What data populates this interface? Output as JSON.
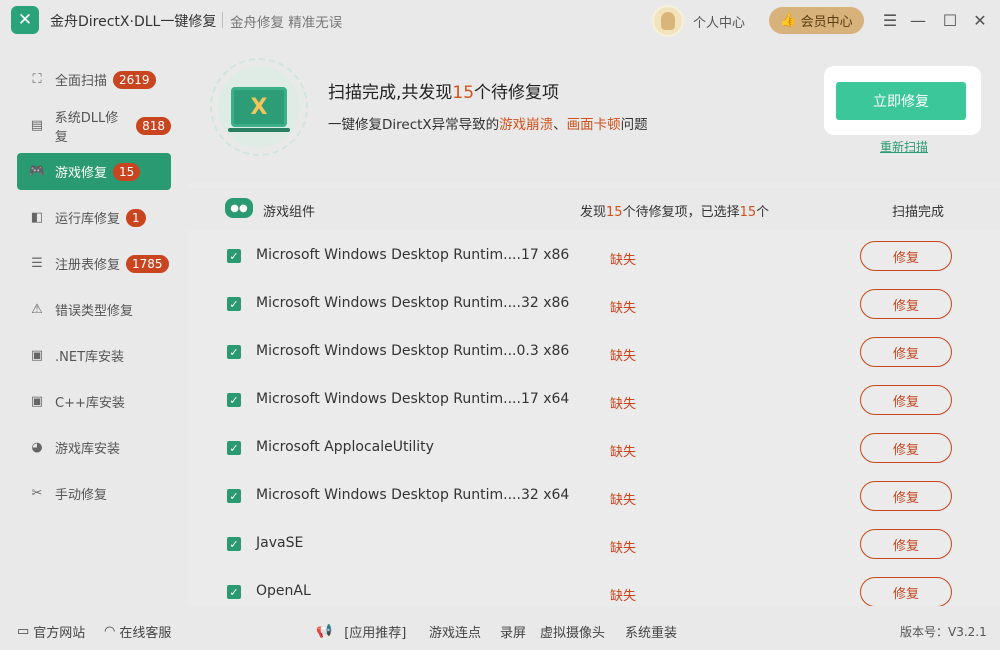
{
  "titlebar": {
    "app_title": "金舟DirectX·DLL一键修复",
    "slogan": "金舟修复 精准无误",
    "user_center": "个人中心",
    "vip_label": "会员中心"
  },
  "sidebar": {
    "items": [
      {
        "label": "全面扫描",
        "badge": "2619",
        "icon": "scan-icon"
      },
      {
        "label": "系统DLL修复",
        "badge": "818",
        "icon": "dll-icon"
      },
      {
        "label": "游戏修复",
        "badge": "15",
        "icon": "gamepad-icon"
      },
      {
        "label": "运行库修复",
        "badge": "1",
        "icon": "runtime-icon"
      },
      {
        "label": "注册表修复",
        "badge": "1785",
        "icon": "registry-icon"
      },
      {
        "label": "错误类型修复",
        "badge": "",
        "icon": "warning-icon"
      },
      {
        "label": ".NET库安装",
        "badge": "",
        "icon": "dotnet-icon"
      },
      {
        "label": "C++库安装",
        "badge": "",
        "icon": "cpp-icon"
      },
      {
        "label": "游戏库安装",
        "badge": "",
        "icon": "pacman-icon"
      },
      {
        "label": "手动修复",
        "badge": "",
        "icon": "tools-icon"
      }
    ]
  },
  "scan": {
    "title_prefix": "扫描完成,共发现",
    "count": "15",
    "title_suffix": "个待修复项",
    "desc_prefix": "一键修复DirectX异常导致的",
    "desc_hl1": "游戏崩溃",
    "desc_sep": "、",
    "desc_hl2": "画面卡顿",
    "desc_suffix": "问题",
    "fix_now": "立即修复",
    "rescan": "重新扫描"
  },
  "table": {
    "col_name": "游戏组件",
    "summary_prefix": "发现",
    "summary_found": "15",
    "summary_mid": "个待修复项，已选择",
    "summary_selected": "15",
    "summary_suffix": "个",
    "col_status": "扫描完成",
    "rows": [
      {
        "name": "Microsoft Windows Desktop Runtim....17 x86",
        "status": "缺失",
        "action": "修复"
      },
      {
        "name": "Microsoft Windows Desktop Runtim....32 x86",
        "status": "缺失",
        "action": "修复"
      },
      {
        "name": "Microsoft Windows Desktop Runtim...0.3 x86",
        "status": "缺失",
        "action": "修复"
      },
      {
        "name": "Microsoft Windows Desktop Runtim....17 x64",
        "status": "缺失",
        "action": "修复"
      },
      {
        "name": "Microsoft ApplocaleUtility",
        "status": "缺失",
        "action": "修复"
      },
      {
        "name": "Microsoft Windows Desktop Runtim....32 x64",
        "status": "缺失",
        "action": "修复"
      },
      {
        "name": "JavaSE",
        "status": "缺失",
        "action": "修复"
      },
      {
        "name": "OpenAL",
        "status": "缺失",
        "action": "修复"
      }
    ]
  },
  "footer": {
    "website": "官方网站",
    "support": "在线客服",
    "recommend": "[应用推荐]",
    "links": [
      "游戏连点",
      "录屏",
      "虚拟摄像头",
      "系统重装"
    ],
    "version": "版本号：V3.2.1"
  },
  "colors": {
    "accent": "#2a9a72",
    "button_green": "#3cc79a",
    "warning": "#c8451f",
    "vip_gold": "#d7b27a"
  }
}
